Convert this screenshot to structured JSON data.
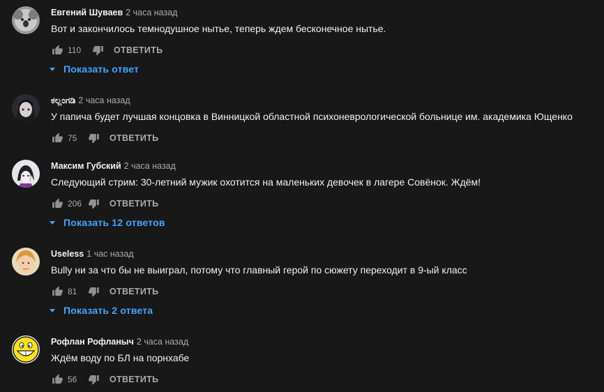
{
  "colors": {
    "background": "#181818",
    "text": "#f1f1f1",
    "muted": "#aaaaaa",
    "link": "#3ea6ff"
  },
  "comments": [
    {
      "author": "Евгений Шуваев",
      "time": "2 часа назад",
      "text": "Вот и закончилось темнодушное нытье, теперь ждем бесконечное нытье.",
      "likes": "110",
      "reply_label": "ОТВЕТИТЬ",
      "show_replies": "Показать ответ"
    },
    {
      "author": "ಕಲ್ಲಂಗಡಿ",
      "time": "2 часа назад",
      "text": "У папича будет лучшая концовка в Винницкой областной психоневрологической больнице им. академика Ющенко",
      "likes": "75",
      "reply_label": "ОТВЕТИТЬ"
    },
    {
      "author": "Максим Губский",
      "time": "2 часа назад",
      "text": "Следующий стрим: 30-летний мужик охотится на маленьких девочек в лагере Совёнок. Ждём!",
      "likes": "206",
      "reply_label": "ОТВЕТИТЬ",
      "show_replies": "Показать 12 ответов"
    },
    {
      "author": "Useless",
      "time": "1 час назад",
      "text": "Bully ни за что бы не выиграл, потому что главный герой по сюжету переходит в 9-ый класс",
      "likes": "81",
      "reply_label": "ОТВЕТИТЬ",
      "show_replies": "Показать 2 ответа"
    },
    {
      "author": "Рофлан Рофланыч",
      "time": "2 часа назад",
      "text": "Ждём воду по БЛ на порнхабе",
      "likes": "56",
      "reply_label": "ОТВЕТИТЬ"
    }
  ],
  "icons": {
    "like": "thumb-up-icon",
    "dislike": "thumb-down-icon",
    "expand": "caret-down-icon"
  }
}
